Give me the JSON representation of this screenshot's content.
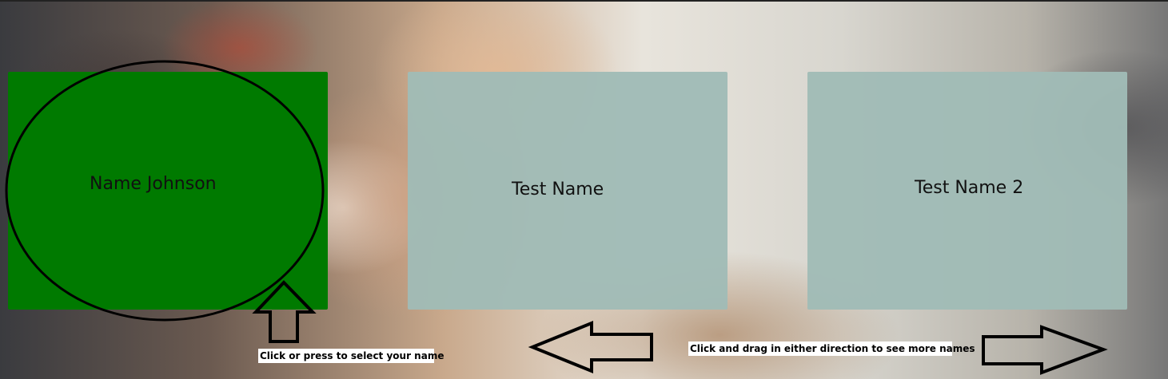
{
  "tiles": [
    {
      "name": "Name Johnson",
      "state": "selected"
    },
    {
      "name": "Test Name",
      "state": "normal"
    },
    {
      "name": "Test Name 2",
      "state": "normal"
    }
  ],
  "hints": {
    "select": "Click or press to select your name",
    "drag": "Click and drag in either direction to see more names"
  },
  "colors": {
    "selected_tile": "#007a00",
    "tile": "#a2bbb6",
    "annotation_stroke": "#000000"
  }
}
